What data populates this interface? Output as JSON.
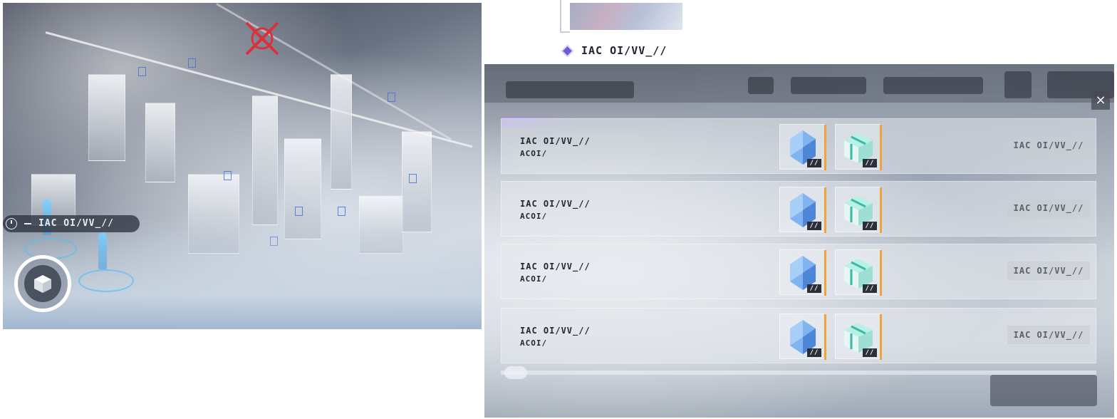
{
  "city_scene": {
    "label": "IAC OI/VV_//"
  },
  "inset": {
    "label": "IAC OI/VV_//"
  },
  "panel": {
    "close_label": "×",
    "missions": [
      {
        "title": "IAC OI/VV_//",
        "subtitle": "ACOI/",
        "reward_count_1": "//",
        "reward_count_2": "//",
        "button_label": "IAC OI/VV_//"
      },
      {
        "title": "IAC OI/VV_//",
        "subtitle": "ACOI/",
        "reward_count_1": "//",
        "reward_count_2": "//",
        "button_label": "IAC OI/VV_//"
      },
      {
        "title": "IAC OI/VV_//",
        "subtitle": "ACOI/",
        "reward_count_1": "//",
        "reward_count_2": "//",
        "button_label": "IAC OI/VV_//"
      },
      {
        "title": "IAC OI/VV_//",
        "subtitle": "ACOI/",
        "reward_count_1": "//",
        "reward_count_2": "//",
        "button_label": "IAC OI/VV_//"
      }
    ]
  },
  "colors": {
    "accent_purple": "#6c5cd6",
    "reward_accent": "#f2a23a",
    "hologram_blue": "#5abef0",
    "marker_red": "#d8323c"
  },
  "icons": [
    "clock-icon",
    "cube-icon",
    "target-marker-icon",
    "diamond-icon",
    "crystal-icon",
    "gift-box-icon",
    "close-icon"
  ]
}
